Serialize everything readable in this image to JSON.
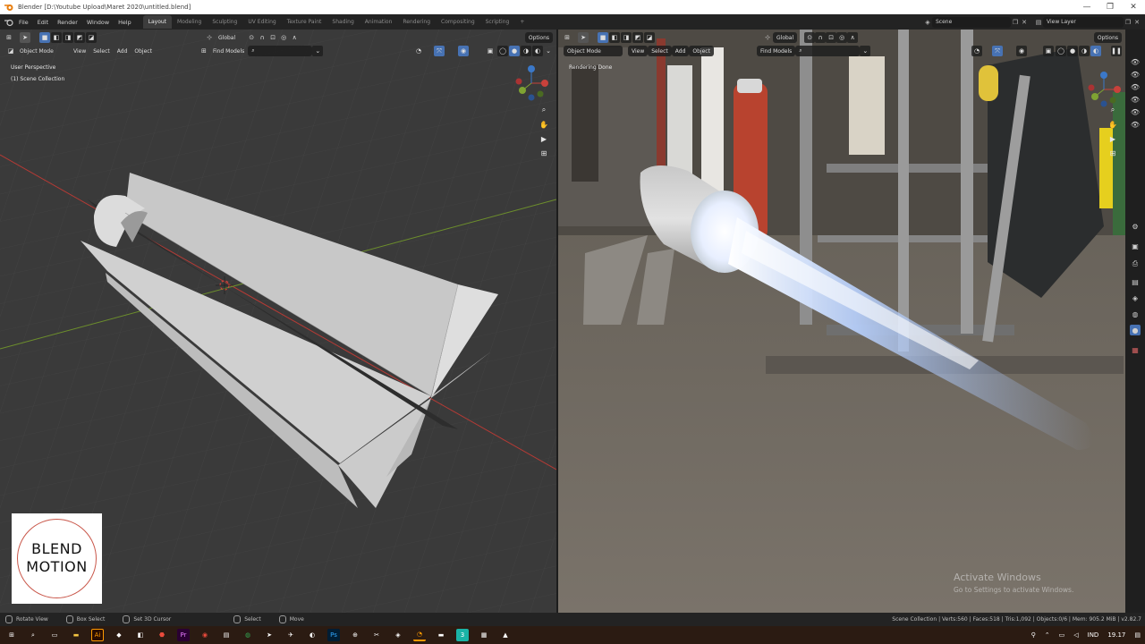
{
  "window": {
    "title": "Blender [D:\\Youtube Upload\\Maret 2020\\untitled.blend]",
    "min": "—",
    "max": "❐",
    "close": "✕"
  },
  "menu": [
    "File",
    "Edit",
    "Render",
    "Window",
    "Help"
  ],
  "workspace_tabs": [
    "Layout",
    "Modeling",
    "Sculpting",
    "UV Editing",
    "Texture Paint",
    "Shading",
    "Animation",
    "Rendering",
    "Compositing",
    "Scripting"
  ],
  "active_tab": "Layout",
  "scene": {
    "name": "Scene",
    "view_layer": "View Layer"
  },
  "left_viewport": {
    "mode": "Object Mode",
    "menus": [
      "View",
      "Select",
      "Add",
      "Object"
    ],
    "orientation": "Global",
    "find": "Find Models",
    "options": "Options",
    "info_line1": "User Perspective",
    "info_line2": "(1) Scene Collection"
  },
  "right_viewport": {
    "mode": "Object Mode",
    "menus": [
      "View",
      "Select",
      "Add",
      "Object"
    ],
    "orientation": "Global",
    "find": "Find Models",
    "options": "Options",
    "info_line1": "Rendering Done"
  },
  "logo": {
    "line1": "BLEND",
    "line2": "MOTION"
  },
  "watermark": {
    "line1": "Activate Windows",
    "line2": "Go to Settings to activate Windows."
  },
  "status": {
    "items": [
      "Rotate View",
      "Box Select",
      "Set 3D Cursor",
      "Select",
      "Move"
    ],
    "stats": "Scene Collection | Verts:560 | Faces:518 | Tris:1,092 | Objects:0/6 | Mem: 905.2 MiB | v2.82.7"
  },
  "taskbar": {
    "lang": "IND",
    "time": "19.17"
  },
  "colors": {
    "accent": "#4772b3",
    "x_axis": "#c8413b",
    "y_axis": "#7fa332",
    "z_axis": "#3b78c8"
  }
}
